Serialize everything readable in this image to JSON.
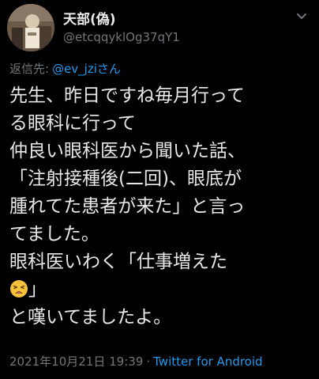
{
  "author": {
    "display_name": "天部(偽)",
    "handle": "@etcqqyklOg37qY1"
  },
  "reply": {
    "label": "返信先:",
    "handle": "@ev_jziさん"
  },
  "tweet": {
    "lines": [
      "先生、昨日ですね毎月行って",
      "る眼科に行って",
      "仲良い眼科医から聞いた話、",
      "「注射接種後(二回)、眼底が",
      "腫れてた患者が来た」と言っ",
      "てました。",
      "眼科医いわく「仕事増えた",
      "」",
      "と嘆いてましたよ。"
    ],
    "emoji": "weary-face-emoji"
  },
  "meta": {
    "timestamp": "2021年10月21日 19:39",
    "separator": "·",
    "source": "Twitter for Android"
  },
  "colors": {
    "background": "#000000",
    "text": "#e7e9ea",
    "secondary": "#71767b",
    "link": "#1d9bf0"
  }
}
